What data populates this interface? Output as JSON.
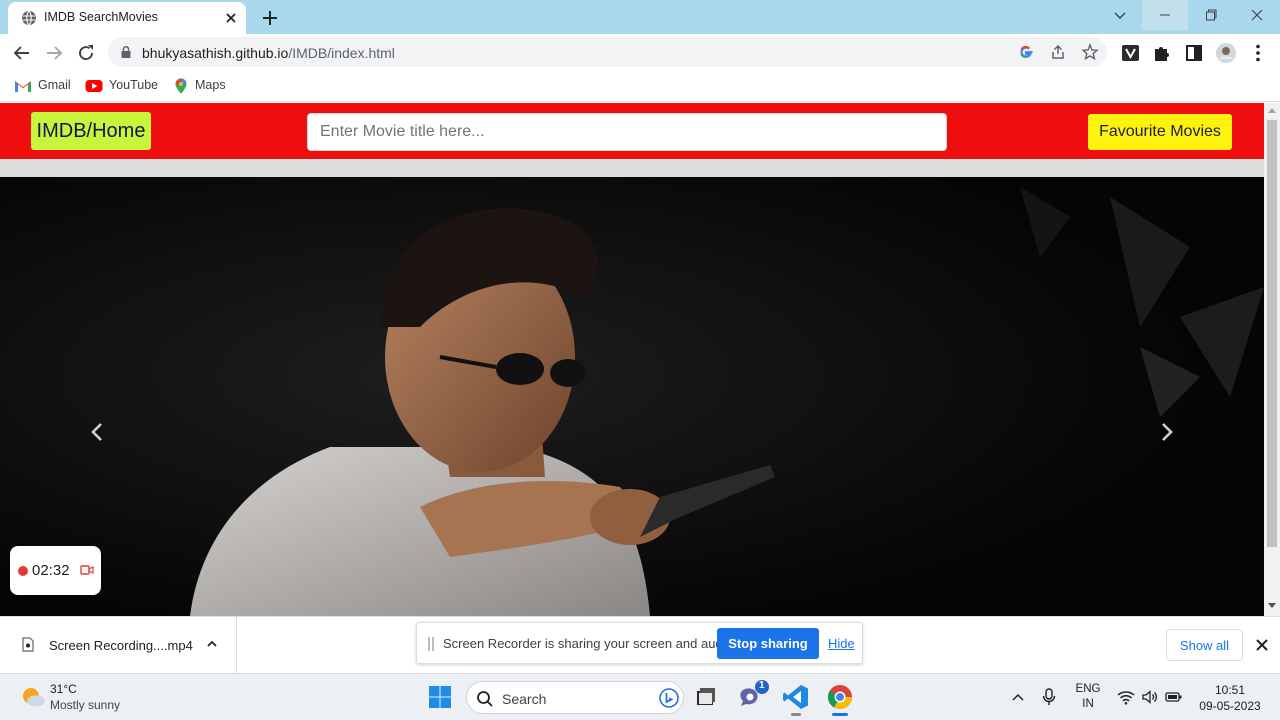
{
  "browser": {
    "tab_title": "IMDB SearchMovies",
    "url_host": "bhukyasathish.github.io",
    "url_path": "/IMDB/index.html",
    "bookmarks": [
      {
        "label": "Gmail",
        "icon": "gmail-icon"
      },
      {
        "label": "YouTube",
        "icon": "youtube-icon"
      },
      {
        "label": "Maps",
        "icon": "maps-icon"
      }
    ]
  },
  "page": {
    "home_label": "IMDB/Home",
    "search_placeholder": "Enter Movie title here...",
    "favourites_label": "Favourite Movies",
    "carousel": {
      "prev_icon": "chevron-left-icon",
      "next_icon": "chevron-right-icon"
    }
  },
  "recorder": {
    "elapsed": "02:32"
  },
  "downloads": {
    "file_name": "Screen Recording....mp4",
    "share_message": "Screen Recorder is sharing your screen and audio.",
    "stop_label": "Stop sharing",
    "hide_label": "Hide",
    "show_all_label": "Show all"
  },
  "taskbar": {
    "temperature": "31°C",
    "weather_condition": "Mostly sunny",
    "search_label": "Search",
    "teams_badge": "1",
    "language_line1": "ENG",
    "language_line2": "IN",
    "time": "10:51",
    "date": "09-05-2023"
  },
  "colors": {
    "navbar_red": "#ee0e0e",
    "home_button": "#c8f53a",
    "favourites_button": "#fff20e",
    "tab_strip": "#a9d8ec",
    "stop_button": "#1a73e8"
  }
}
